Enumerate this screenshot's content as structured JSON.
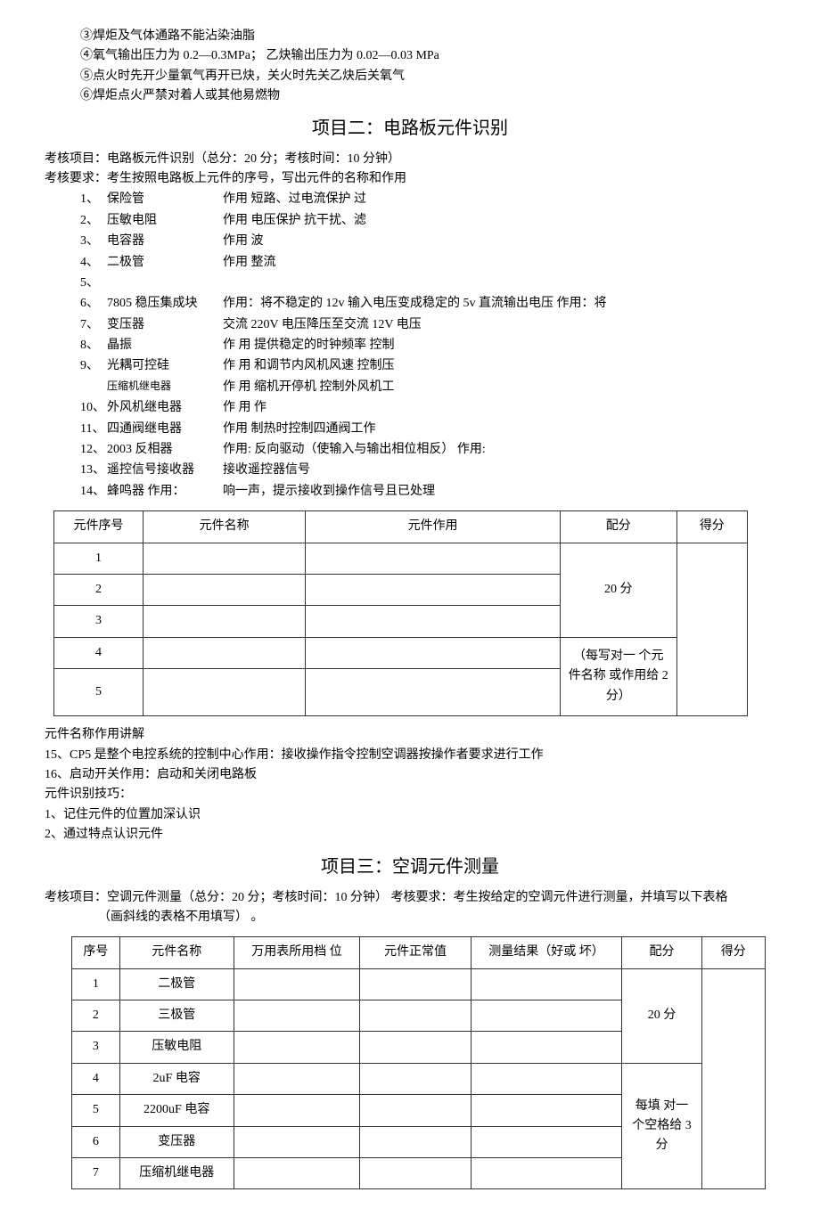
{
  "top_rules": [
    "③焊炬及气体通路不能沾染油脂",
    "④氧气输出压力为 0.2—0.3MPa；  乙炔输出压力为 0.02—0.03 MPa",
    "⑤点火时先开少量氧气再开已炔，关火时先关乙炔后关氧气",
    "⑥焊炬点火严禁对着人或其他易燃物"
  ],
  "project2": {
    "title": "项目二：电路板元件识别",
    "exam_item": "考核项目：电路板元件识别（总分：20 分；考核时间：10 分钟）",
    "exam_req": "考核要求：考生按照电路板上元件的序号，写出元件的名称和作用",
    "components": [
      {
        "num": "1、",
        "name": "保险管",
        "func": "作用     短路、过电流保护 过"
      },
      {
        "num": "2、",
        "name": "压敏电阻",
        "func": "作用     电压保护 抗干扰、滤"
      },
      {
        "num": "3、",
        "name": "电容器",
        "func": "作用     波"
      },
      {
        "num": "4、",
        "name": "二极管",
        "func": "作用     整流"
      },
      {
        "num": "5、",
        "name": "",
        "func": ""
      },
      {
        "num": "6、",
        "name": "7805 稳压集成块",
        "func": "作用：将不稳定的 12v 输入电压变成稳定的 5v 直流输出电压  作用：将"
      },
      {
        "num": "7、",
        "name": "变压器",
        "func": "         交流 220V 电压降压至交流 12V 电压"
      },
      {
        "num": "8、",
        "name": "晶振",
        "func": "作 用     提供稳定的时钟频率 控制"
      },
      {
        "num": "9、",
        "name": "光耦可控硅",
        "func": "作 用     和调节内风机风速 控制压"
      }
    ],
    "components_extra": [
      {
        "num": "",
        "name": "压缩机继电器",
        "func": "作 用     缩机开停机 控制外风机工"
      },
      {
        "num": "10、",
        "name": "外风机继电器",
        "func": "作 用     作"
      },
      {
        "num": "11、",
        "name": "四通阀继电器",
        "func": "作用     制热时控制四通阀工作"
      },
      {
        "num": "12、",
        "name": "2003 反相器",
        "func": "作用: 反向驱动（使输入与输出相位相反） 作用:"
      },
      {
        "num": "13、",
        "name": "遥控信号接收器",
        "func": "         接收遥控器信号"
      },
      {
        "num": "14、",
        "name": "蜂鸣器 作用：",
        "func": "响一声，提示接收到操作信号且已处理"
      }
    ],
    "table1": {
      "headers": [
        "元件序号",
        "元件名称",
        "元件作用",
        "配分",
        "得分"
      ],
      "peifen_top": "20 分",
      "peifen_bottom": "（每写对一 个元件名称 或作用给 2 分）",
      "rows": [
        "1",
        "2",
        "3",
        "4",
        "5"
      ]
    },
    "after_table": [
      "元件名称作用讲解",
      "15、CP5 是整个电控系统的控制中心作用：接收操作指令控制空调器按操作者要求进行工作",
      "16、启动开关作用：启动和关闭电路板",
      "元件识别技巧：",
      "1、记住元件的位置加深认识",
      "2、通过特点认识元件"
    ]
  },
  "project3": {
    "title": "项目三：空调元件测量",
    "exam_line": "考核项目：空调元件测量（总分：20 分；考核时间：10 分钟）  考核要求：考生按给定的空调元件进行测量，并填写以下表格",
    "note": "（画斜线的表格不用填写）  。",
    "table2": {
      "headers": [
        "序号",
        "元件名称",
        "万用表所用档 位",
        "元件正常值",
        "测量结果（好或 坏）",
        "配分",
        "得分"
      ],
      "peifen_top": "20 分",
      "peifen_bottom": "每填 对一 个空格给 3 分",
      "rows": [
        {
          "num": "1",
          "name": "二极管"
        },
        {
          "num": "2",
          "name": "三极管"
        },
        {
          "num": "3",
          "name": "压敏电阻"
        },
        {
          "num": "4",
          "name": "2uF 电容"
        },
        {
          "num": "5",
          "name": "2200uF 电容"
        },
        {
          "num": "6",
          "name": "变压器"
        },
        {
          "num": "7",
          "name": "压缩机继电器"
        }
      ]
    }
  }
}
